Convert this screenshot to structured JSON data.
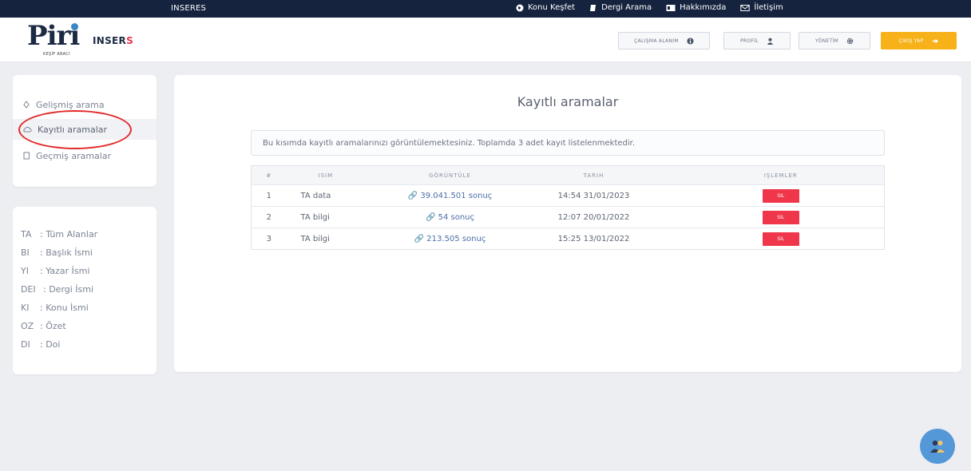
{
  "topbar": {
    "brand": "INSERES",
    "nav": [
      {
        "label": "Konu Keşfet",
        "icon": "globe-icon"
      },
      {
        "label": "Dergi Arama",
        "icon": "book-icon"
      },
      {
        "label": "Hakkımızda",
        "icon": "id-card-icon"
      },
      {
        "label": "İletişim",
        "icon": "mail-icon"
      }
    ]
  },
  "header": {
    "logo_text": "Piri",
    "logo_sub": "KEŞİF ARACI",
    "inser_main": "INSER",
    "inser_s": "S",
    "buttons": {
      "workspace": "ÇALIŞMA ALANIM",
      "profile": "PROFİL",
      "admin": "YÖNETİM",
      "logout": "ÇIKIŞ YAP"
    }
  },
  "sidebar": {
    "items": [
      {
        "label": "Gelişmiş arama",
        "icon": "diamond-icon"
      },
      {
        "label": "Kayıtlı aramalar",
        "icon": "cloud-icon"
      },
      {
        "label": "Geçmiş aramalar",
        "icon": "document-icon"
      }
    ],
    "abbreviations": [
      {
        "key": "TA",
        "value": ": Tüm Alanlar"
      },
      {
        "key": "BI",
        "value": ": Başlık İsmi"
      },
      {
        "key": "YI",
        "value": ": Yazar İsmi"
      },
      {
        "key": "DEI",
        "value": ": Dergi İsmi"
      },
      {
        "key": "KI",
        "value": ": Konu İsmi"
      },
      {
        "key": "OZ",
        "value": ": Özet"
      },
      {
        "key": "DI",
        "value": ": Doi"
      }
    ]
  },
  "main": {
    "title": "Kayıtlı aramalar",
    "info": "Bu kısımda kayıtlı aramalarınızı görüntülemektesiniz. Toplamda 3 adet kayıt listelenmektedir.",
    "columns": [
      "#",
      "ISIM",
      "GÖRÜNTÜLE",
      "TARIH",
      "IŞLEMLER"
    ],
    "rows": [
      {
        "index": "1",
        "name": "TA data",
        "view": "39.041.501 sonuç",
        "date": "14:54 31/01/2023",
        "action": "SIL"
      },
      {
        "index": "2",
        "name": "TA bilgi",
        "view": "54 sonuç",
        "date": "12:07 20/01/2022",
        "action": "SIL"
      },
      {
        "index": "3",
        "name": "TA bilgi",
        "view": "213.505 sonuç",
        "date": "15:25 13/01/2022",
        "action": "SIL"
      }
    ]
  },
  "colors": {
    "topbar": "#16233f",
    "accent": "#f7b21a",
    "delete": "#f0364a",
    "annotation": "#e22a2a",
    "fab": "#5598d8"
  }
}
